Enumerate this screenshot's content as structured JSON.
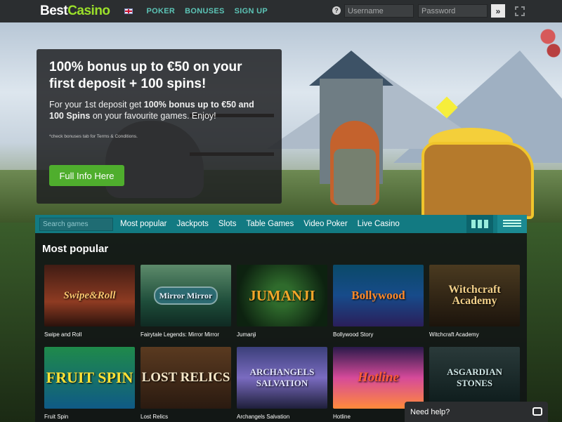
{
  "header": {
    "logo_part1": "Best",
    "logo_part2": "Casino",
    "nav": [
      "POKER",
      "BONUSES",
      "SIGN UP"
    ],
    "help_symbol": "?",
    "username_placeholder": "Username",
    "password_placeholder": "Password",
    "login_symbol": "»"
  },
  "promo": {
    "title": "100% bonus up to €50 on your first deposit + 100 spins!",
    "body_prefix": "For your 1st deposit get ",
    "body_bold": "100% bonus up to €50 and 100 Spins",
    "body_suffix": " on your favourite games. Enjoy!",
    "note": "*check bonuses tab for Terms & Conditions.",
    "cta": "Full Info Here"
  },
  "carousel": {
    "dots": 3,
    "active": 1
  },
  "games_bar": {
    "search_placeholder": "Search games",
    "categories": [
      "Most popular",
      "Jackpots",
      "Slots",
      "Table Games",
      "Video Poker",
      "Live Casino"
    ]
  },
  "section": {
    "title": "Most popular",
    "games": [
      {
        "name": "Swipe and Roll",
        "art": "Swipe&Roll"
      },
      {
        "name": "Fairytale Legends: Mirror Mirror",
        "art": "Mirror Mirror"
      },
      {
        "name": "Jumanji",
        "art": "JUMANJI"
      },
      {
        "name": "Bollywood Story",
        "art": "Bollywood"
      },
      {
        "name": "Witchcraft Academy",
        "art": "Witchcraft Academy"
      },
      {
        "name": "Fruit Spin",
        "art": "FRUIT SPIN"
      },
      {
        "name": "Lost Relics",
        "art": "LOST RELICS"
      },
      {
        "name": "Archangels Salvation",
        "art": "ARCHANGELS SALVATION"
      },
      {
        "name": "Hotline",
        "art": "Hotline"
      },
      {
        "name": "",
        "art": "ASGARDIAN STONES"
      }
    ]
  },
  "help_chat": {
    "label": "Need help?"
  },
  "colors": {
    "brand_green": "#9be02a",
    "nav_teal": "#5cc4b6",
    "bar_teal": "#127a82",
    "cta_green": "#4fae2d"
  }
}
